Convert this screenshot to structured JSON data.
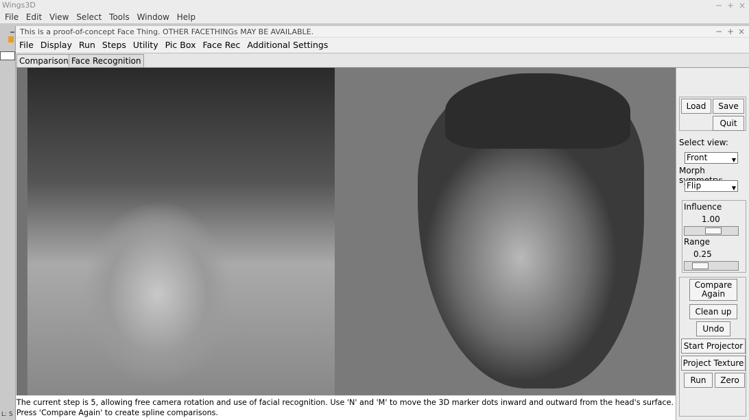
{
  "outer": {
    "title": "Wings3D",
    "menu": [
      "File",
      "Edit",
      "View",
      "Select",
      "Tools",
      "Window",
      "Help"
    ],
    "status": "L: S"
  },
  "window": {
    "title": "This is a proof-of-concept Face Thing.  OTHER FACETHINGs MAY BE AVAILABLE.",
    "menu": [
      "File",
      "Display",
      "Run",
      "Steps",
      "Utility",
      "Pic Box",
      "Face Rec",
      "Additional Settings"
    ],
    "tabs": [
      "Comparisons",
      "Face Recognition"
    ]
  },
  "message": {
    "line1": "The current step is 5, allowing free camera rotation and use of facial recognition.  Use 'N' and 'M' to move the 3D marker dots inward and outward from the head's surface.",
    "line2": "Press 'Compare Again' to create spline comparisons."
  },
  "side": {
    "load": "Load",
    "save": "Save",
    "quit": "Quit",
    "select_view_label": "Select view:",
    "select_view_value": "Front",
    "morph_label": "Morph symmetry:",
    "morph_value": "Flip",
    "influence_label": "Influence",
    "influence_value": "1.00",
    "influence_level": 0.55,
    "range_label": "Range",
    "range_value": "0.25",
    "range_level": 0.2,
    "compare_again": "Compare Again",
    "clean_up": "Clean up",
    "undo": "Undo",
    "start_projector": "Start Projector",
    "project_texture": "Project Texture",
    "run": "Run",
    "zero": "Zero"
  }
}
